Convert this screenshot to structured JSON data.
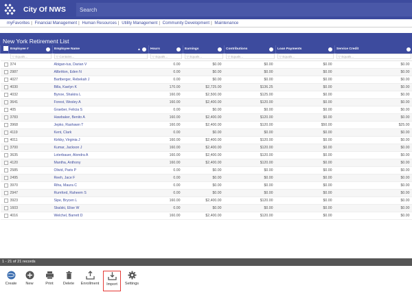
{
  "app": {
    "title": "City Of NWS",
    "search_placeholder": "Search"
  },
  "menu": [
    "myFavorites",
    "Financial Management",
    "Human Resources",
    "Utility Management",
    "Community Development",
    "Maintenance"
  ],
  "page": {
    "title": "New York Retirement List"
  },
  "columns": [
    {
      "label": "Employee #",
      "filter": "Equals..."
    },
    {
      "label": "Employee Name",
      "filter": "Contains..."
    },
    {
      "label": "Hours",
      "filter": "Equals..."
    },
    {
      "label": "Earnings",
      "filter": "Equals..."
    },
    {
      "label": "Contributions",
      "filter": "Equals..."
    },
    {
      "label": "Loan Payments",
      "filter": "Equals..."
    },
    {
      "label": "Service Credit",
      "filter": "Equals..."
    }
  ],
  "rows": [
    {
      "emp": "374",
      "name": "Abigan-tus, Darian V",
      "hours": "0.00",
      "earnings": "$0.00",
      "contrib": "$0.00",
      "loan": "$0.00",
      "credit": "$0.00"
    },
    {
      "emp": "2987",
      "name": "Allbritton, Eden N",
      "hours": "0.00",
      "earnings": "$0.00",
      "contrib": "$0.00",
      "loan": "$0.00",
      "credit": "$0.00"
    },
    {
      "emp": "4027",
      "name": "Bartberger, Rebekah J",
      "hours": "0.00",
      "earnings": "$0.00",
      "contrib": "$0.00",
      "loan": "$0.00",
      "credit": "$0.00"
    },
    {
      "emp": "4030",
      "name": "Billa, Kaelyn K",
      "hours": "170.00",
      "earnings": "$2,725.00",
      "contrib": "$136.25",
      "loan": "$0.00",
      "credit": "$0.00"
    },
    {
      "emp": "4032",
      "name": "Bynoe, Shakira L",
      "hours": "160.00",
      "earnings": "$2,500.00",
      "contrib": "$125.00",
      "loan": "$0.00",
      "credit": "$0.00"
    },
    {
      "emp": "3641",
      "name": "Forest, Wesley A",
      "hours": "160.00",
      "earnings": "$2,400.00",
      "contrib": "$120.00",
      "loan": "$0.00",
      "credit": "$0.00"
    },
    {
      "emp": "405",
      "name": "Graeber, Felicia S",
      "hours": "0.00",
      "earnings": "$0.00",
      "contrib": "$0.00",
      "loan": "$0.00",
      "credit": "$0.00"
    },
    {
      "emp": "3783",
      "name": "Hawbaker, Benito A",
      "hours": "160.00",
      "earnings": "$2,400.00",
      "contrib": "$120.00",
      "loan": "$0.00",
      "credit": "$0.00"
    },
    {
      "emp": "3968",
      "name": "Jepko, Rashawn T",
      "hours": "160.00",
      "earnings": "$2,400.00",
      "contrib": "$120.00",
      "loan": "$50.00",
      "credit": "$25.00"
    },
    {
      "emp": "4119",
      "name": "Kent, Clark",
      "hours": "0.00",
      "earnings": "$0.00",
      "contrib": "$0.00",
      "loan": "$0.00",
      "credit": "$0.00"
    },
    {
      "emp": "4011",
      "name": "Kirkby, Virginia J",
      "hours": "160.00",
      "earnings": "$2,400.00",
      "contrib": "$120.00",
      "loan": "$0.00",
      "credit": "$0.00"
    },
    {
      "emp": "3700",
      "name": "Kumar, Jackson J",
      "hours": "160.00",
      "earnings": "$2,400.00",
      "contrib": "$120.00",
      "loan": "$0.00",
      "credit": "$0.00"
    },
    {
      "emp": "3635",
      "name": "Loterbauer, Alondra A",
      "hours": "160.00",
      "earnings": "$2,400.00",
      "contrib": "$120.00",
      "loan": "$0.00",
      "credit": "$0.00"
    },
    {
      "emp": "4120",
      "name": "Mantha, Anthony",
      "hours": "160.00",
      "earnings": "$2,400.00",
      "contrib": "$120.00",
      "loan": "$0.00",
      "credit": "$0.00"
    },
    {
      "emp": "2585",
      "name": "Olivid, Paris P",
      "hours": "0.00",
      "earnings": "$0.00",
      "contrib": "$0.00",
      "loan": "$0.00",
      "credit": "$0.00"
    },
    {
      "emp": "2495",
      "name": "Reeh, Jace F",
      "hours": "0.00",
      "earnings": "$0.00",
      "contrib": "$0.00",
      "loan": "$0.00",
      "credit": "$0.00"
    },
    {
      "emp": "3970",
      "name": "Riha, Maura C",
      "hours": "0.00",
      "earnings": "$0.00",
      "contrib": "$0.00",
      "loan": "$0.00",
      "credit": "$0.00"
    },
    {
      "emp": "2947",
      "name": "Rumford, Raheem S",
      "hours": "0.00",
      "earnings": "$0.00",
      "contrib": "$0.00",
      "loan": "$0.00",
      "credit": "$0.00"
    },
    {
      "emp": "3923",
      "name": "Sipe, Brycen L",
      "hours": "160.00",
      "earnings": "$2,400.00",
      "contrib": "$120.00",
      "loan": "$0.00",
      "credit": "$0.00"
    },
    {
      "emp": "1603",
      "name": "Skalski, Elise W",
      "hours": "0.00",
      "earnings": "$0.00",
      "contrib": "$0.00",
      "loan": "$0.00",
      "credit": "$0.00"
    },
    {
      "emp": "4016",
      "name": "Welchel, Barrett D",
      "hours": "160.00",
      "earnings": "$2,400.00",
      "contrib": "$120.00",
      "loan": "$0.00",
      "credit": "$0.00"
    }
  ],
  "status": {
    "records": "1 - 21 of 21 records"
  },
  "toolbar": [
    {
      "label": "Create",
      "icon": "create-globe-icon"
    },
    {
      "label": "New",
      "icon": "plus-circle-icon"
    },
    {
      "label": "Print",
      "icon": "printer-icon"
    },
    {
      "label": "Delete",
      "icon": "trash-icon"
    },
    {
      "label": "Enrollment",
      "icon": "upload-tray-icon"
    },
    {
      "label": "Import",
      "icon": "download-tray-icon",
      "active": true
    },
    {
      "label": "Settings",
      "icon": "gear-icon"
    }
  ],
  "colors": {
    "brand": "#3d4b9e",
    "highlight_border": "#e53935",
    "status_bg": "#555555"
  }
}
